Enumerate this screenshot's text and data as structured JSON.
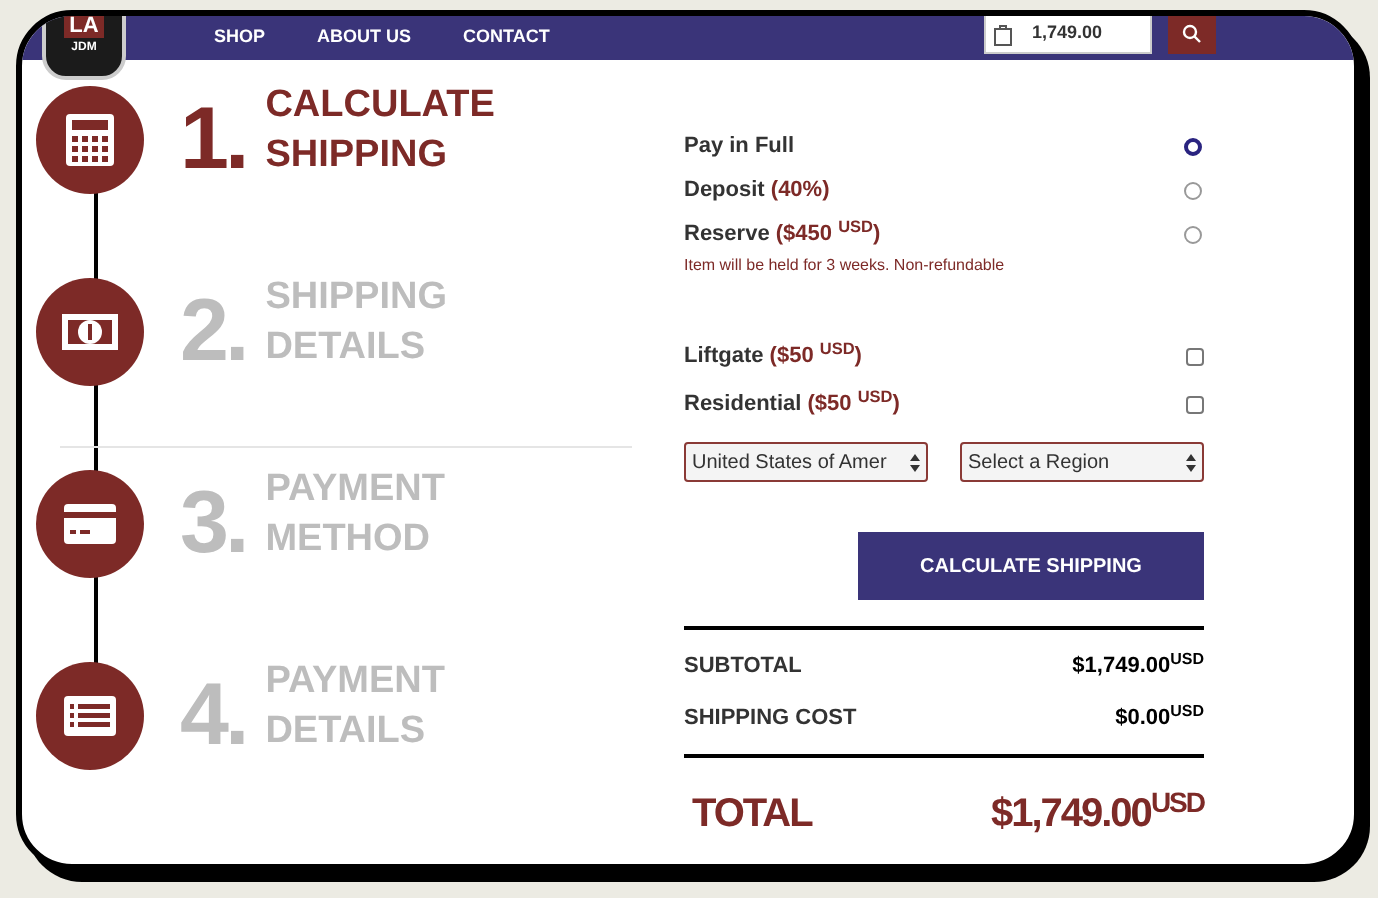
{
  "logo": {
    "top": "LA",
    "bottom": "JDM"
  },
  "nav": [
    "SHOP",
    "ABOUT US",
    "CONTACT"
  ],
  "cart": {
    "amount": "1,749.00"
  },
  "steps": [
    {
      "number": "1.",
      "line1": "CALCULATE",
      "line2": "SHIPPING",
      "selected": true
    },
    {
      "number": "2.",
      "line1": "SHIPPING",
      "line2": "DETAILS",
      "selected": false
    },
    {
      "number": "3.",
      "line1": "PAYMENT",
      "line2": "METHOD",
      "selected": false
    },
    {
      "number": "4.",
      "line1": "PAYMENT",
      "line2": "DETAILS",
      "selected": false
    }
  ],
  "payment_options": [
    {
      "label": "Pay in Full",
      "selected": true
    },
    {
      "label": "Deposit",
      "price": "(40%)",
      "selected": false
    },
    {
      "label": "Reserve",
      "price": "($450 $^{USD}$)",
      "note": "Item will be held for 3 weeks. Non-refundable",
      "selected": false
    }
  ],
  "extras": [
    {
      "label": "Liftgate",
      "price": "($50 $^{USD}$)",
      "checked": false
    },
    {
      "label": "Residential",
      "price": "($50 $^{USD}$)",
      "checked": false
    }
  ],
  "country_select": {
    "value": "United States of Amer"
  },
  "region_select": {
    "value": "Select a Region"
  },
  "calculate_button": "CALCULATE SHIPPING",
  "summary": [
    {
      "label": "SUBTOTAL",
      "value": "$1,749.00",
      "unit": "USD"
    },
    {
      "label": "SHIPPING COST",
      "value": "$0.00",
      "unit": "USD"
    }
  ],
  "total": {
    "label": "TOTAL",
    "value": "$1,749.00",
    "unit": "USD"
  }
}
